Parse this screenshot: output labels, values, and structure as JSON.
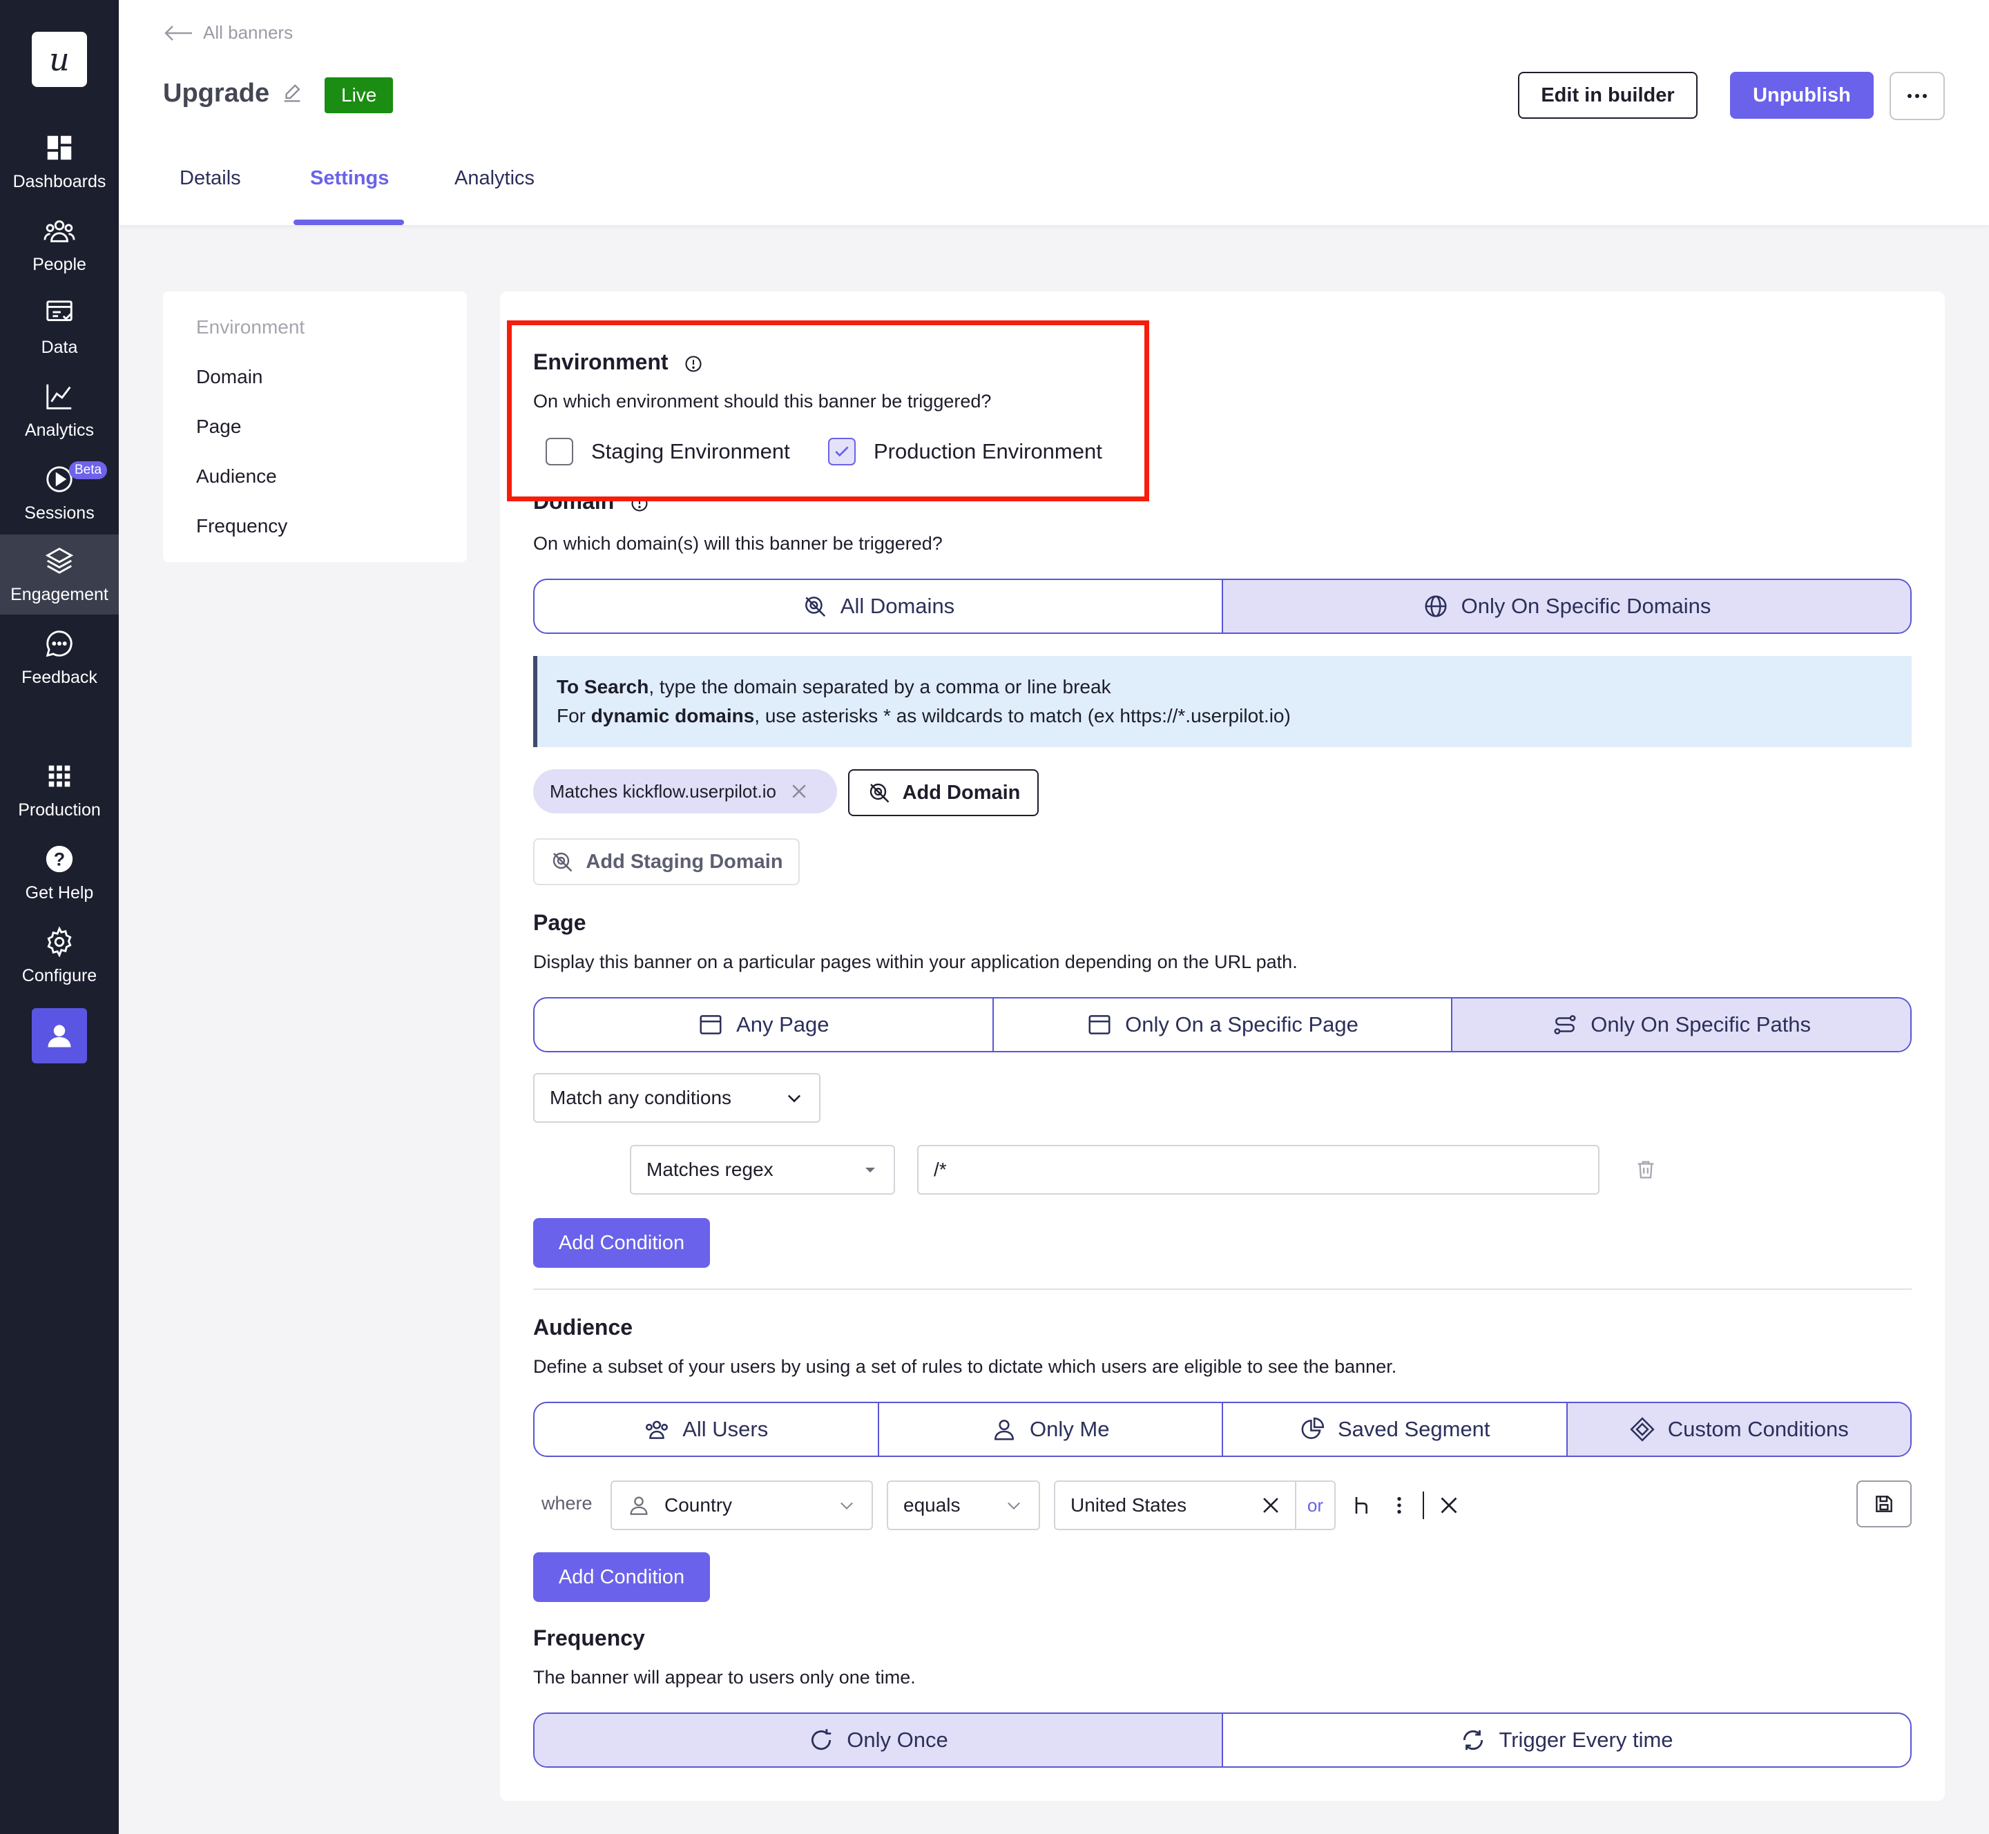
{
  "sidebar": {
    "logo": "u",
    "items": [
      {
        "label": "Dashboards",
        "icon": "dashboards-icon"
      },
      {
        "label": "People",
        "icon": "people-icon"
      },
      {
        "label": "Data",
        "icon": "data-icon"
      },
      {
        "label": "Analytics",
        "icon": "analytics-icon"
      },
      {
        "label": "Sessions",
        "icon": "sessions-icon",
        "badge": "Beta"
      },
      {
        "label": "Engagement",
        "icon": "engagement-icon",
        "active": true
      },
      {
        "label": "Feedback",
        "icon": "feedback-icon"
      },
      {
        "label": "Production",
        "icon": "grid-icon"
      },
      {
        "label": "Get Help",
        "icon": "help-icon"
      },
      {
        "label": "Configure",
        "icon": "gear-icon"
      }
    ]
  },
  "header": {
    "back_label": "All banners",
    "title": "Upgrade",
    "status": "Live",
    "edit_button": "Edit in builder",
    "unpublish_button": "Unpublish",
    "tabs": [
      "Details",
      "Settings",
      "Analytics"
    ],
    "active_tab": "Settings"
  },
  "section_nav": [
    "Environment",
    "Domain",
    "Page",
    "Audience",
    "Frequency"
  ],
  "environment": {
    "title": "Environment",
    "description": "On which environment should this banner be triggered?",
    "options": [
      {
        "label": "Staging Environment",
        "checked": false
      },
      {
        "label": "Production Environment",
        "checked": true
      }
    ]
  },
  "domain": {
    "title": "Domain",
    "description": "On which domain(s) will this banner be triggered?",
    "options": [
      "All Domains",
      "Only On Specific Domains"
    ],
    "selected": "Only On Specific Domains",
    "info_bold_1": "To Search",
    "info_text_1": ", type the domain separated by a comma or line break",
    "info_prefix_2": "For ",
    "info_bold_2": "dynamic domains",
    "info_text_2": ", use asterisks * as wildcards to match (ex https://*.userpilot.io)",
    "chip": "Matches kickflow.userpilot.io",
    "add_domain": "Add Domain",
    "add_staging_domain": "Add Staging Domain"
  },
  "page": {
    "title": "Page",
    "description": "Display this banner on a particular pages within your application depending on the URL path.",
    "options": [
      "Any Page",
      "Only On a Specific Page",
      "Only On Specific Paths"
    ],
    "selected": "Only On Specific Paths",
    "match_select": "Match any conditions",
    "condition_operator": "Matches regex",
    "condition_value": "/*",
    "add_condition": "Add Condition"
  },
  "audience": {
    "title": "Audience",
    "description": "Define a subset of your users by using a set of rules to dictate which users are eligible to see the banner.",
    "options": [
      "All Users",
      "Only Me",
      "Saved Segment",
      "Custom Conditions"
    ],
    "selected": "Custom Conditions",
    "where_label": "where",
    "property": "Country",
    "operator": "equals",
    "value": "United States",
    "or_label": "or",
    "add_condition": "Add Condition"
  },
  "frequency": {
    "title": "Frequency",
    "description": "The banner will appear to users only one time.",
    "options": [
      "Only Once",
      "Trigger Every time"
    ],
    "selected": "Only Once"
  },
  "colors": {
    "accent": "#6a62ea",
    "live": "#1a8d12",
    "highlight": "#f51d0b",
    "sidebar": "#1c1f2e"
  }
}
